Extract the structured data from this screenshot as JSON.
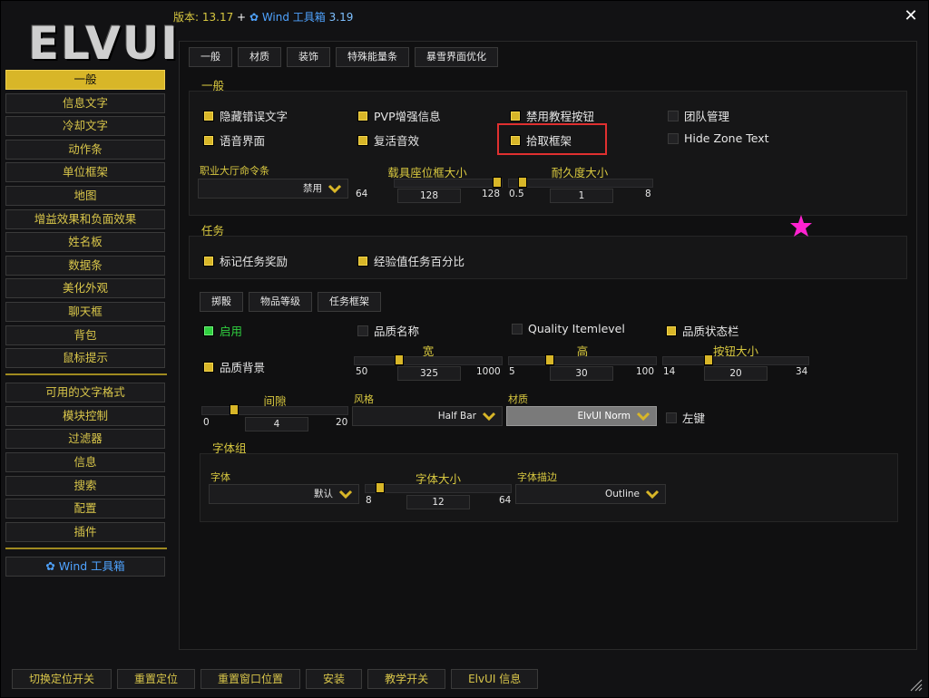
{
  "logo": {
    "text": "ELVUI"
  },
  "header": {
    "version_label": "版本: 13.17",
    "plus": "+",
    "wind_label": "Wind 工具箱",
    "wind_version": "3.19",
    "close_glyph": "✕"
  },
  "sidebar": {
    "items": [
      {
        "label": "一般",
        "active": true
      },
      {
        "label": "信息文字"
      },
      {
        "label": "冷却文字"
      },
      {
        "label": "动作条"
      },
      {
        "label": "单位框架"
      },
      {
        "label": "地图"
      },
      {
        "label": "增益效果和负面效果"
      },
      {
        "label": "姓名板"
      },
      {
        "label": "数据条"
      },
      {
        "label": "美化外观"
      },
      {
        "label": "聊天框"
      },
      {
        "label": "背包"
      },
      {
        "label": "鼠标提示"
      }
    ],
    "items2": [
      {
        "label": "可用的文字格式"
      },
      {
        "label": "模块控制"
      },
      {
        "label": "过滤器"
      },
      {
        "label": "信息"
      },
      {
        "label": "搜索"
      },
      {
        "label": "配置"
      },
      {
        "label": "插件"
      }
    ],
    "wind_item": {
      "label": "Wind 工具箱",
      "icon": "wind-icon"
    }
  },
  "tabs": [
    "一般",
    "材质",
    "装饰",
    "特殊能量条",
    "暴雪界面优化"
  ],
  "general": {
    "title": "一般",
    "checkboxes": [
      {
        "label": "隐藏错误文字",
        "checked": true
      },
      {
        "label": "PVP增强信息",
        "checked": true
      },
      {
        "label": "禁用教程按钮",
        "checked": true
      },
      {
        "label": "团队管理",
        "checked": false
      },
      {
        "label": "语音界面",
        "checked": true
      },
      {
        "label": "复活音效",
        "checked": true
      },
      {
        "label": "拾取框架",
        "checked": true
      },
      {
        "label": "Hide Zone Text",
        "checked": false
      }
    ],
    "classhall": {
      "label": "职业大厅命令条",
      "value": "禁用"
    },
    "vehicle": {
      "title": "载具座位框大小",
      "min": "64",
      "max": "128",
      "value": "128",
      "fraction": 1.0
    },
    "durability": {
      "title": "耐久度大小",
      "min": "0.5",
      "max": "8",
      "value": "1",
      "fraction": 0.067
    }
  },
  "quests": {
    "title": "任务",
    "checkboxes": [
      {
        "label": "标记任务奖励",
        "checked": true
      },
      {
        "label": "经验值任务百分比",
        "checked": true
      }
    ]
  },
  "subtabs": [
    "掷骰",
    "物品等级",
    "任务框架"
  ],
  "loot": {
    "enable": {
      "label": "启用",
      "checked": true
    },
    "quality_name": {
      "label": "品质名称",
      "checked": false
    },
    "quality_itemlevel": {
      "label": "Quality Itemlevel",
      "checked": false
    },
    "quality_statusbar": {
      "label": "品质状态栏",
      "checked": true
    },
    "quality_bg": {
      "label": "品质背景",
      "checked": true
    },
    "width": {
      "title": "宽",
      "min": "50",
      "max": "1000",
      "value": "325",
      "fraction": 0.289
    },
    "height": {
      "title": "高",
      "min": "5",
      "max": "100",
      "value": "30",
      "fraction": 0.263
    },
    "button_size": {
      "title": "按钮大小",
      "min": "14",
      "max": "34",
      "value": "20",
      "fraction": 0.3
    },
    "spacing": {
      "title": "间隙",
      "min": "0",
      "max": "20",
      "value": "4",
      "fraction": 0.2
    },
    "style": {
      "label": "风格",
      "value": "Half Bar"
    },
    "texture": {
      "label": "材质",
      "value": "ElvUI Norm"
    },
    "left_click": {
      "label": "左键",
      "checked": false
    },
    "font_group": {
      "title": "字体组",
      "font": {
        "label": "字体",
        "value": "默认"
      },
      "font_size": {
        "title": "字体大小",
        "min": "8",
        "max": "64",
        "value": "12",
        "fraction": 0.071
      },
      "outline": {
        "label": "字体描边",
        "value": "Outline"
      }
    }
  },
  "bottom_buttons": [
    "切换定位开关",
    "重置定位",
    "重置窗口位置",
    "安装",
    "教学开关",
    "ElvUI 信息"
  ],
  "colors": {
    "accent": "#d8b628",
    "text_gold": "#d8c840",
    "enabled_green": "#30d040",
    "highlight_red": "#e03030",
    "wind_blue": "#4fa3ff",
    "star_magenta": "#ff22d0"
  }
}
